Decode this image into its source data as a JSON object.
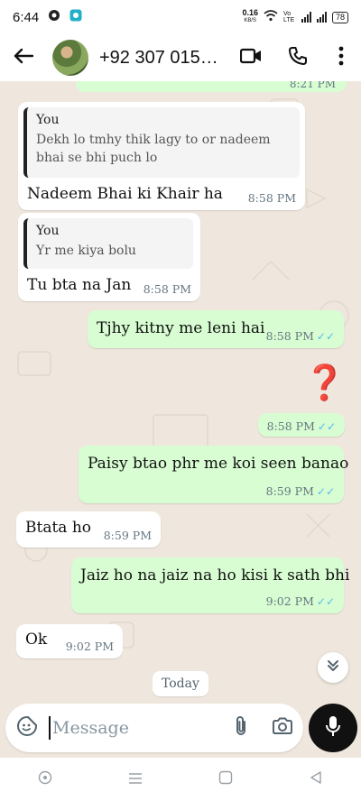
{
  "status_bar": {
    "time": "6:44",
    "data_speed_value": "0.16",
    "data_speed_unit": "KB/S",
    "network_label": "Vo LTE",
    "battery": "78"
  },
  "header": {
    "contact_name": "+92 307 015…"
  },
  "chat": {
    "partial_time": "8:21 PM",
    "messages": [
      {
        "reply_from": "You",
        "reply_text": "Dekh lo tmhy thik lagy to or nadeem bhai se bhi puch lo",
        "text": "Nadeem Bhai ki Khair ha",
        "time": "8:58 PM"
      },
      {
        "reply_from": "You",
        "reply_text": "Yr me kiya bolu",
        "text": "Tu bta na Jan",
        "time": "8:58 PM"
      },
      {
        "text": "Tjhy kitny me leni hai",
        "time": "8:58 PM",
        "ticks": "✓✓"
      },
      {
        "text": "❓",
        "time": "8:58 PM",
        "ticks": "✓✓"
      },
      {
        "text": "Paisy btao phr me koi seen banao",
        "time": "8:59 PM",
        "ticks": "✓✓"
      },
      {
        "text": "Btata ho",
        "time": "8:59 PM"
      },
      {
        "text": "Jaiz ho na jaiz na ho kisi k sath bhi",
        "time": "9:02 PM",
        "ticks": "✓✓"
      },
      {
        "text": "Ok",
        "time": "9:02 PM"
      }
    ],
    "date_chip": "Today"
  },
  "composer": {
    "placeholder": "Message"
  },
  "icons": {
    "back": "arrow-left-icon",
    "video": "video-call-icon",
    "call": "phone-icon",
    "menu": "more-vert-icon",
    "emoji": "sticker-icon",
    "attach": "paperclip-icon",
    "camera": "camera-icon",
    "mic": "mic-icon",
    "scroll": "double-chevron-down-icon"
  },
  "colors": {
    "outgoing_bubble": "#d8fdd2",
    "incoming_bubble": "#ffffff",
    "chat_background": "#efe7dd",
    "read_ticks": "#53bdeb",
    "mic_button": "#111111"
  }
}
